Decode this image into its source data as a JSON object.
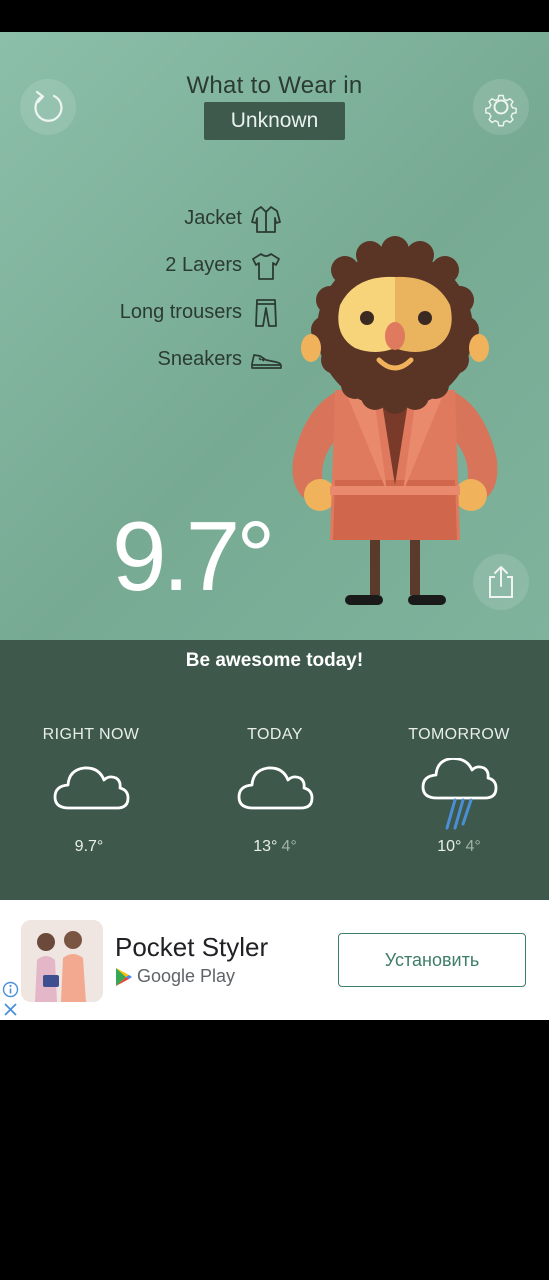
{
  "header": {
    "title": "What to Wear in",
    "location": "Unknown",
    "refresh_icon": "refresh-icon",
    "settings_icon": "gear-icon"
  },
  "clothing": [
    {
      "label": "Jacket",
      "icon": "jacket-icon"
    },
    {
      "label": "2 Layers",
      "icon": "tshirt-icon"
    },
    {
      "label": "Long trousers",
      "icon": "trousers-icon"
    },
    {
      "label": "Sneakers",
      "icon": "sneaker-icon"
    }
  ],
  "current_temperature": "9.7°",
  "share_icon": "share-icon",
  "motto": "Be awesome today!",
  "forecast": [
    {
      "label": "RIGHT NOW",
      "icon": "cloud-icon",
      "high": "9.7°",
      "low": ""
    },
    {
      "label": "TODAY",
      "icon": "cloud-icon",
      "high": "13°",
      "low": "4°"
    },
    {
      "label": "TOMORROW",
      "icon": "rain-cloud-icon",
      "high": "10°",
      "low": "4°"
    }
  ],
  "ad": {
    "title": "Pocket Styler",
    "store": "Google Play",
    "install_label": "Установить",
    "info_icon": "info-icon",
    "close_icon": "close-icon"
  },
  "colors": {
    "hero_background": "#7fb39c",
    "panel_background": "#3e584c",
    "install_accent": "#3e7d67",
    "rain_blue": "#4a8fd6"
  }
}
